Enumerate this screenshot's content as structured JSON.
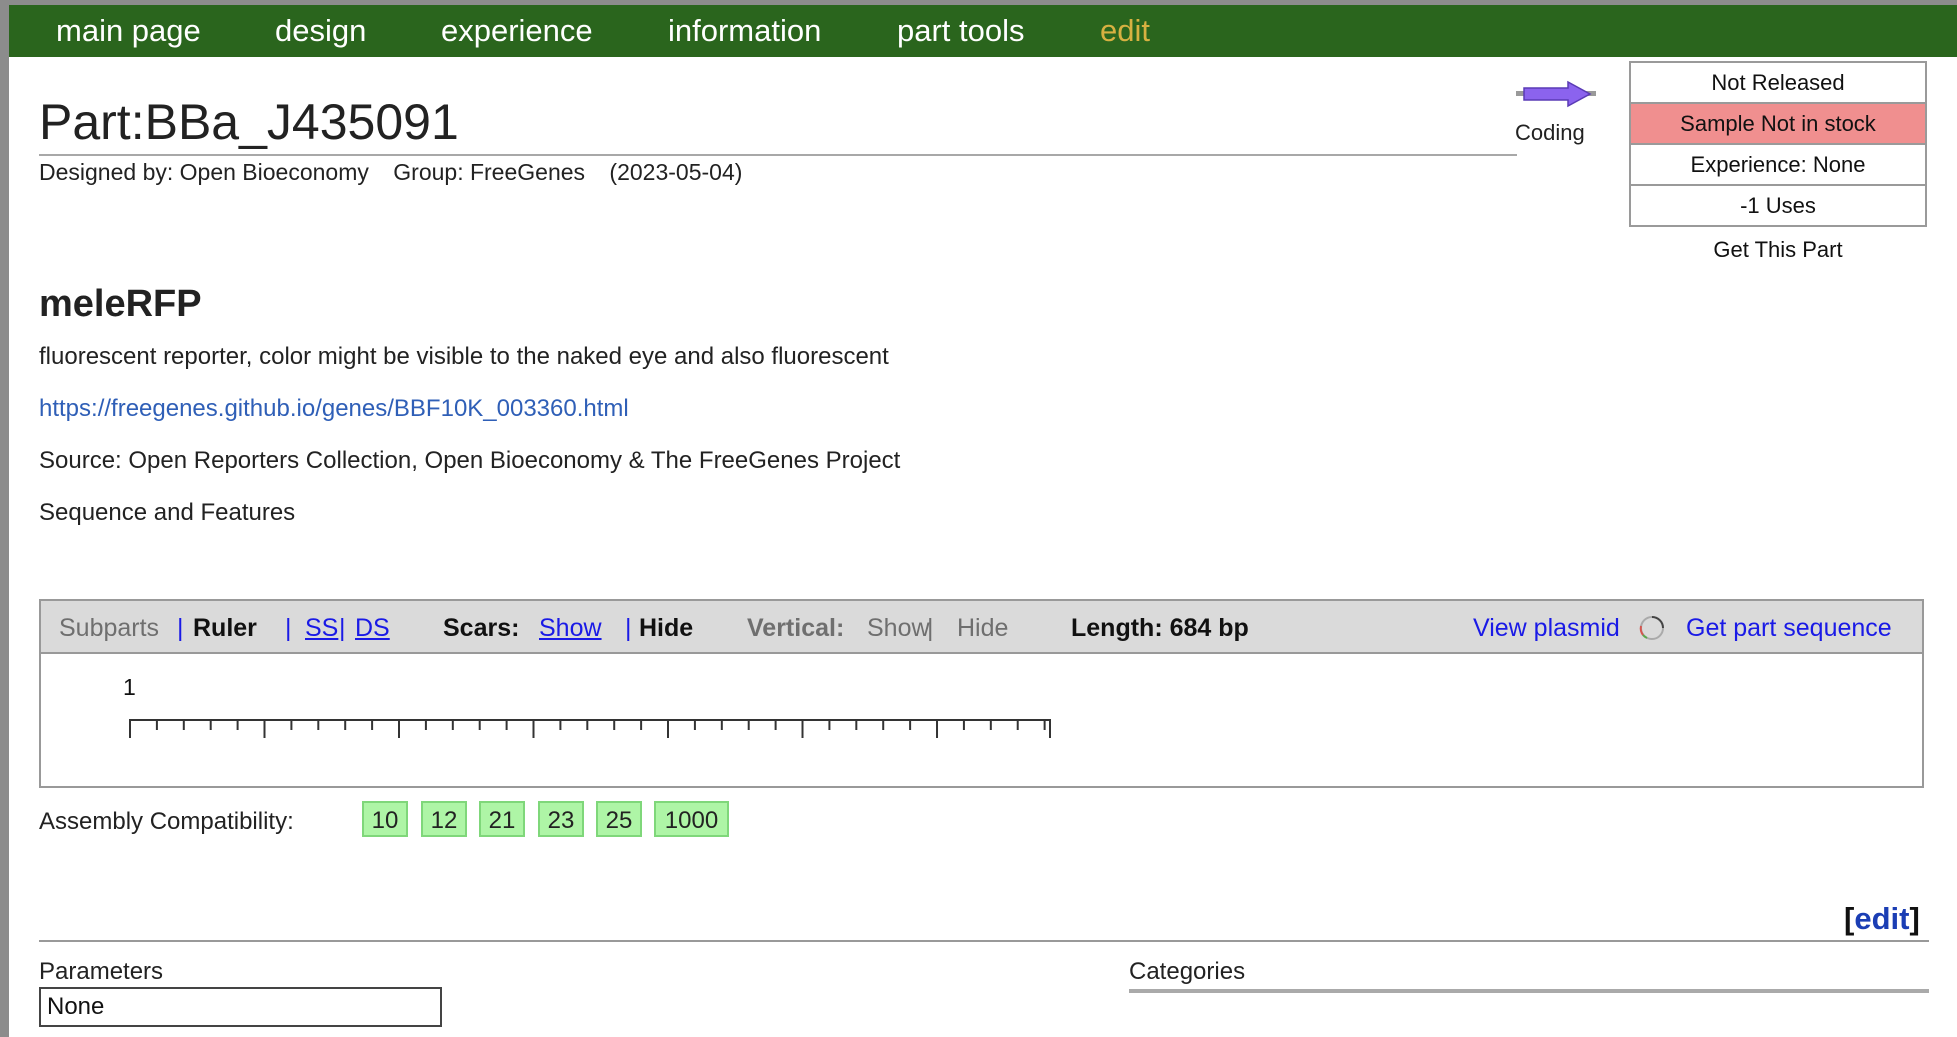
{
  "nav": {
    "items": [
      {
        "label": "main page",
        "name": "nav-main-page"
      },
      {
        "label": "design",
        "name": "nav-design"
      },
      {
        "label": "experience",
        "name": "nav-experience"
      },
      {
        "label": "information",
        "name": "nav-information"
      },
      {
        "label": "part tools",
        "name": "nav-part-tools"
      },
      {
        "label": "edit",
        "name": "nav-edit"
      }
    ],
    "background": "#2a651d",
    "edit_color": "#d7b141"
  },
  "part": {
    "title": "Part:BBa_J435091",
    "designed_by": "Designed by: Open Bioeconomy",
    "group": "Group: FreeGenes",
    "date": "(2023-05-04)",
    "type_icon": "coding-arrow-icon",
    "type_label": "Coding"
  },
  "status": {
    "released": "Not Released",
    "sample": "Sample Not in stock",
    "experience": "Experience: None",
    "uses": "-1 Uses",
    "get_part": "Get This Part",
    "sample_color": "#f08f8f"
  },
  "content": {
    "short_name": "meleRFP",
    "description": "fluorescent reporter, color might be visible to the naked eye and also fluorescent",
    "url": "https://freegenes.github.io/genes/BBF10K_003360.html",
    "source": "Source: Open Reporters Collection, Open Bioeconomy & The FreeGenes Project",
    "sequence_features": "Sequence and Features"
  },
  "viewer": {
    "subparts": "Subparts",
    "sep": "|",
    "ruler": "Ruler",
    "ss": "SS",
    "ds": "DS",
    "scars_label": "Scars:",
    "scars_show": "Show",
    "scars_hide": "Hide",
    "vertical_label": "Vertical:",
    "vertical_show": "Show",
    "vertical_hide": "Hide",
    "length": "Length: 684 bp",
    "view_plasmid": "View plasmid",
    "plasmid_icon": "plasmid-circle-icon",
    "get_sequence": "Get part sequence",
    "ruler_start": "1",
    "sequence_length": 684
  },
  "assembly": {
    "label": "Assembly Compatibility:",
    "standards": [
      "10",
      "12",
      "21",
      "23",
      "25",
      "1000"
    ],
    "color": "#aef5a6"
  },
  "footer": {
    "edit_open": "[",
    "edit": "edit",
    "edit_close": "]",
    "parameters_label": "Parameters",
    "parameters_value": "None",
    "categories_label": "Categories"
  }
}
